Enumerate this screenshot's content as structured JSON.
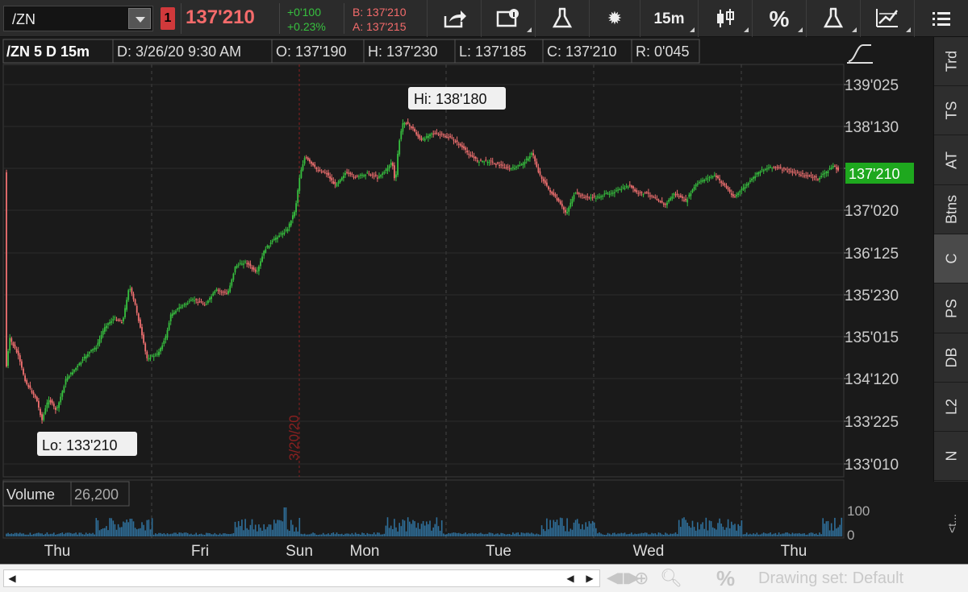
{
  "toolbar": {
    "symbol": "/ZN",
    "link_badge": "1",
    "last_price": "137'210",
    "net_change": "+0'100",
    "pct_change": "+0.23%",
    "bid": "B: 137'210",
    "ask": "A: 137'215",
    "timeframe": "15m",
    "percent_label": "%"
  },
  "header": {
    "symbol_period": "/ZN 5 D 15m",
    "date": "D: 3/26/20 9:30 AM",
    "open": "O: 137'190",
    "high": "H: 137'230",
    "low": "L: 137'185",
    "close": "C: 137'210",
    "range": "R: 0'045"
  },
  "chart": {
    "hi_label": "Hi: 138'180",
    "lo_label": "Lo: 133'210",
    "price_badge": "137'210",
    "event_date": "3/20/20",
    "price_ticks": [
      "139'025",
      "138'130",
      "137'020",
      "136'125",
      "135'230",
      "135'015",
      "134'120",
      "133'225",
      "133'010"
    ],
    "day_labels": [
      "Thu",
      "Fri",
      "Sun",
      "Mon",
      "Tue",
      "Wed",
      "Thu"
    ]
  },
  "volume": {
    "label": "Volume",
    "value": "26,200",
    "tick": "100",
    "tick_zero": "0"
  },
  "right_panel": {
    "tabs": [
      "Trd",
      "TS",
      "AT",
      "Btns",
      "C",
      "PS",
      "DB",
      "L2",
      "N"
    ],
    "active_tab": "C",
    "collapse_label": "<t..."
  },
  "bottom": {
    "drawing_set": "Drawing set: Default",
    "percent_label": "%"
  },
  "colors": {
    "up": "#37c03f",
    "down": "#f07070",
    "price_badge_bg": "#1ea81e",
    "event_line": "#8a2020"
  },
  "chart_data": {
    "type": "candlestick",
    "symbol": "/ZN",
    "interval": "15m",
    "period": "5 D",
    "session_labels": [
      "Thu",
      "Fri",
      "Sun",
      "Mon",
      "Tue",
      "Wed",
      "Thu"
    ],
    "high_marker": "138'180",
    "low_marker": "133'210",
    "last": "137'210",
    "path_close": [
      134.25,
      133.9,
      133.4,
      133.7,
      134.6,
      135.0,
      135.3,
      135.6,
      134.4,
      134.8,
      135.6,
      135.8,
      136.4,
      136.9,
      138.0,
      137.8,
      138.4,
      138.1,
      137.9,
      137.6,
      137.7,
      137.3,
      137.05,
      137.2,
      137.1,
      137.3,
      137.5,
      137.2,
      137.7,
      137.65,
      137.5,
      137.62
    ],
    "volume_peaks": [
      55,
      50,
      48,
      80,
      35,
      62,
      88,
      40,
      30,
      46,
      38,
      32
    ]
  }
}
